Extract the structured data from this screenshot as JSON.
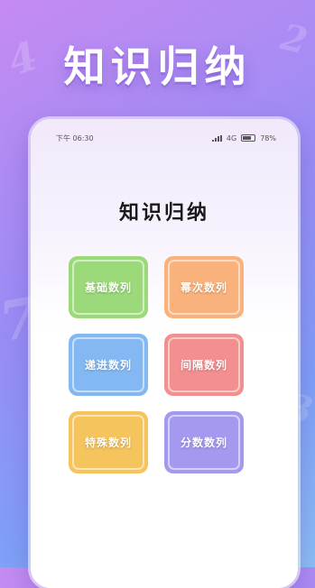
{
  "promo": {
    "title": "知识归纳"
  },
  "status_bar": {
    "time": "下午 06:30",
    "network": "4G",
    "battery": "78%"
  },
  "page": {
    "title": "知识归纳"
  },
  "cards": [
    {
      "label": "基础数列",
      "color": "#9bd97a"
    },
    {
      "label": "幂次数列",
      "color": "#f9b27c"
    },
    {
      "label": "递进数列",
      "color": "#84b8f3"
    },
    {
      "label": "间隔数列",
      "color": "#f48f8f"
    },
    {
      "label": "特殊数列",
      "color": "#f6c45c"
    },
    {
      "label": "分数数列",
      "color": "#a39af0"
    }
  ],
  "decor": {
    "glyphs": [
      "4",
      "2",
      "7",
      "3"
    ]
  }
}
